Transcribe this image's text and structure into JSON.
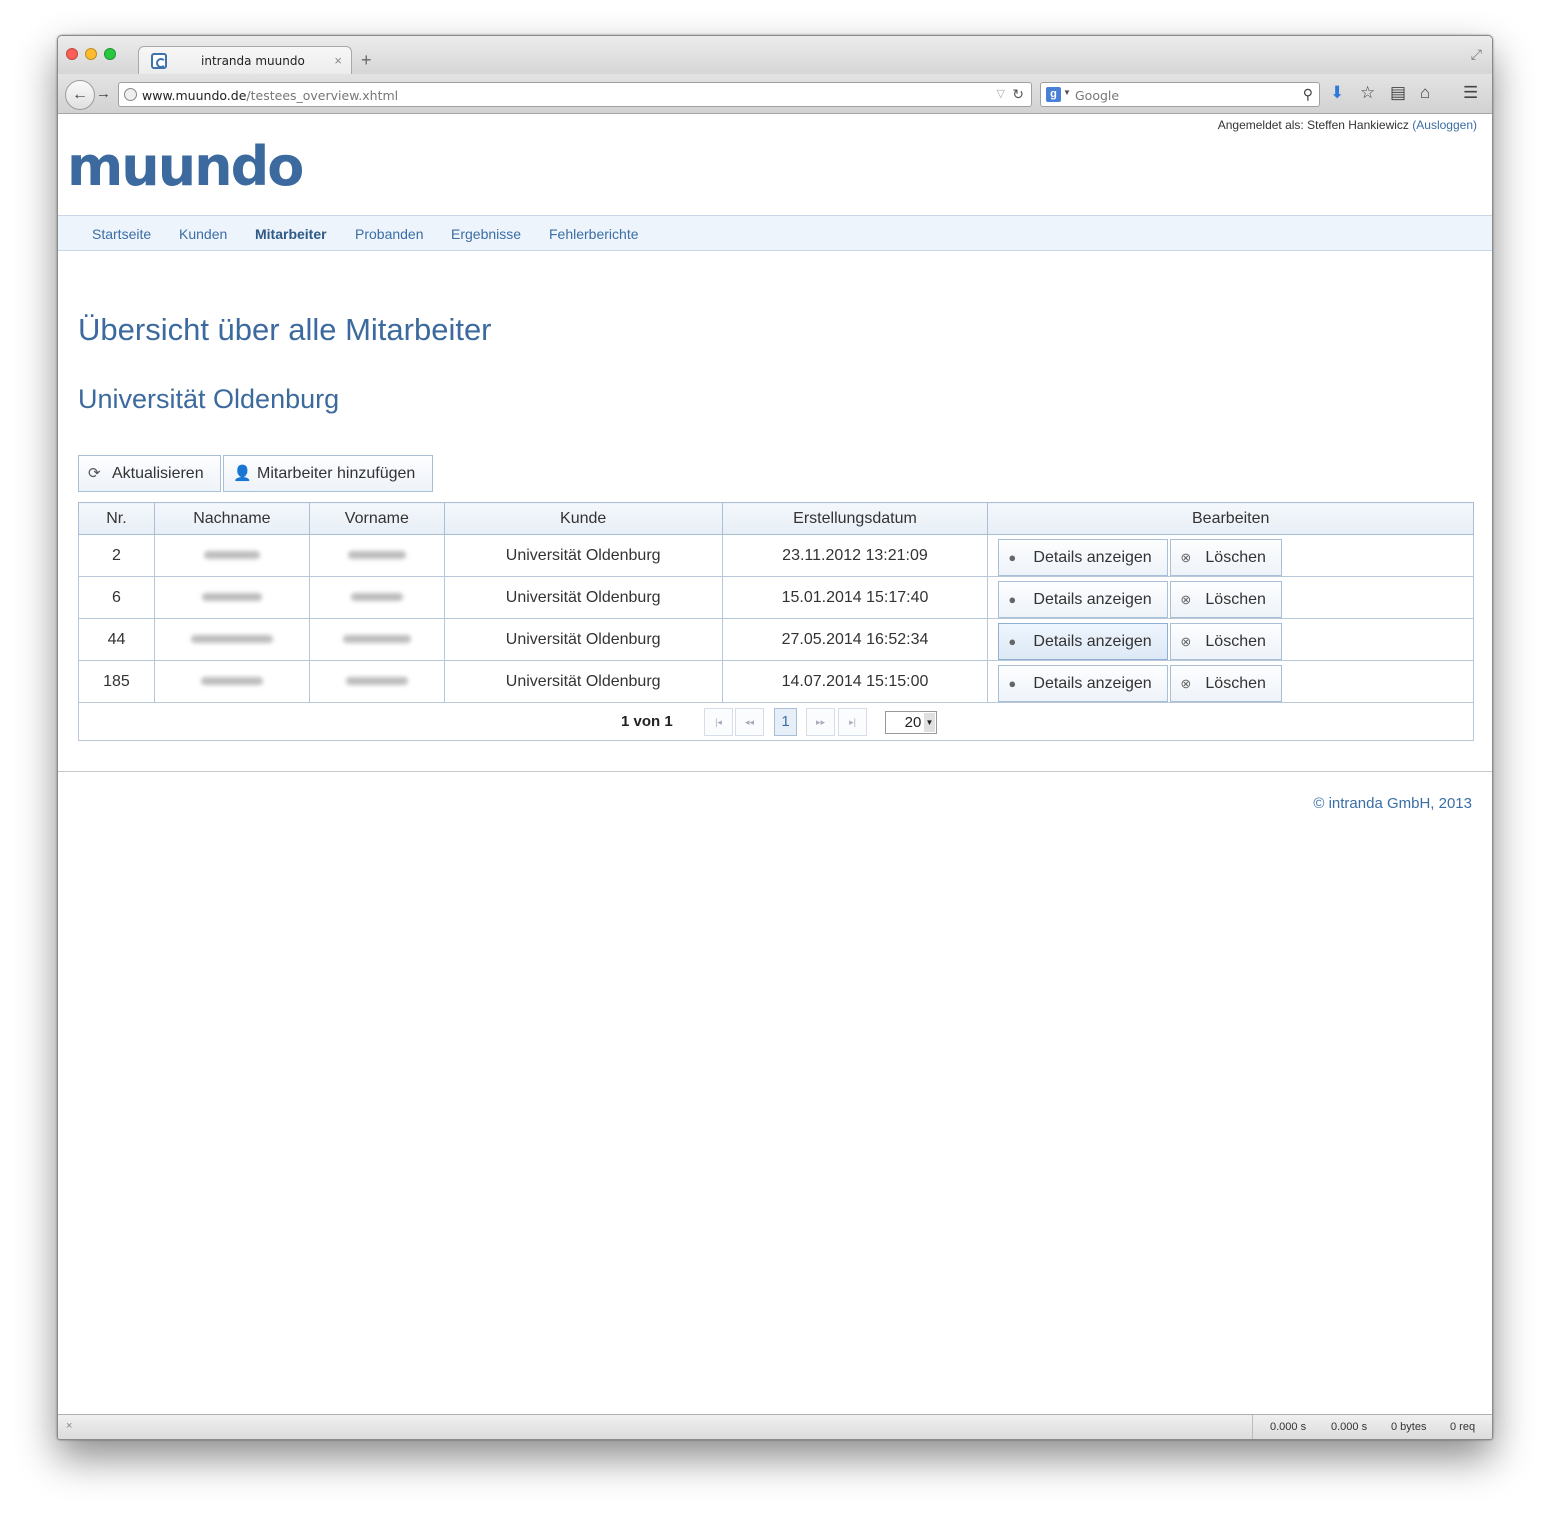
{
  "browser": {
    "tab_title": "intranda muundo",
    "tab_close": "×",
    "new_tab": "+",
    "url_host": "www.muundo.de",
    "url_path": "/testees_overview.xhtml",
    "search_engine_letter": "g",
    "search_placeholder": "Google"
  },
  "header": {
    "login_prefix": "Angemeldet als: Steffen Hankiewicz ",
    "logout_label": "(Ausloggen)",
    "logo_text": "muundo"
  },
  "nav": {
    "items": [
      "Startseite",
      "Kunden",
      "Mitarbeiter",
      "Probanden",
      "Ergebnisse",
      "Fehlerberichte"
    ],
    "active": "Mitarbeiter"
  },
  "main": {
    "title": "Übersicht über alle Mitarbeiter",
    "customer": "Universität Oldenburg",
    "refresh_label": "Aktualisieren",
    "add_label": "Mitarbeiter hinzufügen"
  },
  "table": {
    "headers": [
      "Nr.",
      "Nachname",
      "Vorname",
      "Kunde",
      "Erstellungsdatum",
      "Bearbeiten"
    ],
    "rows": [
      {
        "nr": "2",
        "kunde": "Universität Oldenburg",
        "datum": "23.11.2012 13:21:09"
      },
      {
        "nr": "6",
        "kunde": "Universität Oldenburg",
        "datum": "15.01.2014 15:17:40"
      },
      {
        "nr": "44",
        "kunde": "Universität Oldenburg",
        "datum": "27.05.2014 16:52:34"
      },
      {
        "nr": "185",
        "kunde": "Universität Oldenburg",
        "datum": "14.07.2014 15:15:00"
      }
    ],
    "details_label": "Details anzeigen",
    "delete_label": "Löschen"
  },
  "pager": {
    "summary": "1 von 1",
    "current_page": "1",
    "rows_per_page": "20"
  },
  "footer": {
    "copyright": "© intranda GmbH, 2013"
  },
  "statusbar": {
    "close": "×",
    "time1": "0.000 s",
    "time2": "0.000 s",
    "bytes": "0 bytes",
    "requests": "0 req"
  },
  "colors": {
    "brand": "#3c6a9e",
    "link": "#3a6ea5",
    "nav_bg": "#eef4fb",
    "border": "#a8bfd6"
  }
}
